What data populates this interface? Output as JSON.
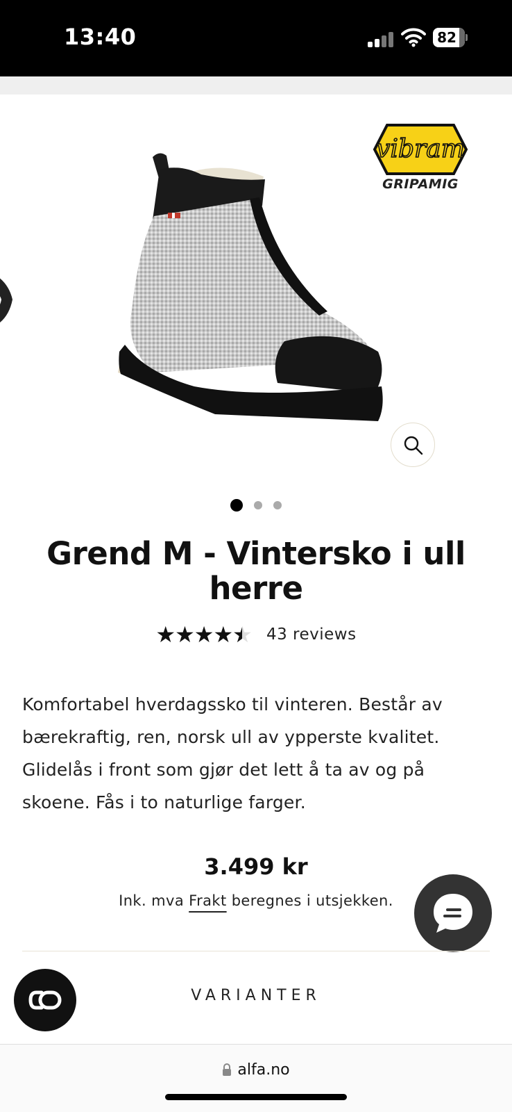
{
  "status_bar": {
    "time": "13:40",
    "battery": "82"
  },
  "product": {
    "title": "Grend M - Vintersko i ull herre",
    "rating": 4.5,
    "reviews_label": "43 reviews",
    "description": "Komfortabel hverdagssko til vinteren. Består av bærekraftig, ren, norsk ull av ypperste kvalitet. Glidelås i front som gjør det lett å ta av og på skoene. Fås i to naturlige farger.",
    "price": "3.499 kr",
    "price_note_prefix": "Ink. mva ",
    "price_note_link": "Frakt",
    "price_note_suffix": " beregnes i utsjekken.",
    "variants_label": "VARIANTER",
    "image_slides": 3,
    "active_slide": 1
  },
  "badge": {
    "brand": "vibram",
    "sub": "GRIPAMIG"
  },
  "browser": {
    "url": "alfa.no"
  },
  "icons": {
    "zoom": "magnifier-icon",
    "chat": "chat-bubble-icon",
    "widget": "co-logo-icon",
    "lock": "lock-icon"
  },
  "colors": {
    "accent": "#111111",
    "vibram_yellow": "#f7d117"
  }
}
